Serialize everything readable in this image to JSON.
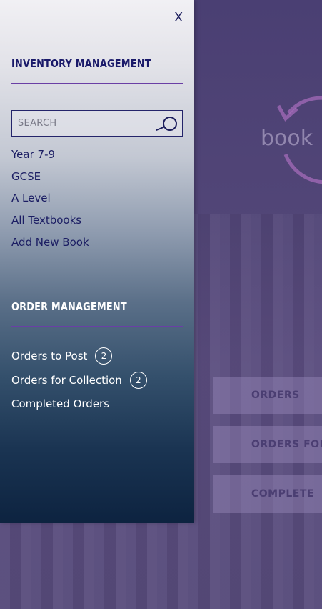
{
  "drawer": {
    "close_label": "X",
    "inventory": {
      "title": "INVENTORY MANAGEMENT",
      "search_placeholder": "SEARCH",
      "items": [
        {
          "label": "Year 7-9"
        },
        {
          "label": "GCSE"
        },
        {
          "label": "A Level"
        },
        {
          "label": "All Textbooks"
        },
        {
          "label": "Add New Book"
        }
      ]
    },
    "orders": {
      "title": "ORDER MANAGEMENT",
      "items": [
        {
          "label": "Orders to Post",
          "count": "2"
        },
        {
          "label": "Orders for Collection",
          "count": "2"
        },
        {
          "label": "Completed Orders"
        }
      ]
    }
  },
  "background": {
    "logo_text": "book",
    "buttons": [
      {
        "label": "ORDERS"
      },
      {
        "label": "ORDERS FOR"
      },
      {
        "label": "COMPLETE"
      }
    ]
  },
  "colors": {
    "accent_purple": "#6a3fa5",
    "nav_text": "#1b1d63",
    "drawer_dark": "#0d2340"
  }
}
